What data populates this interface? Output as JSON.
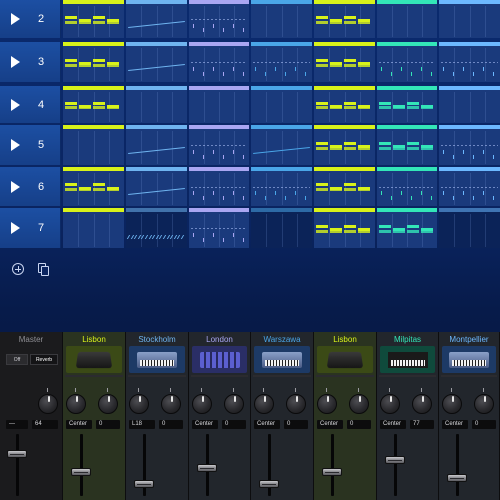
{
  "colors": {
    "lime": "#d8f21a",
    "blue": "#6fb4f0",
    "lavender": "#a9a6f2",
    "sky": "#4aa6e8",
    "teal": "#33e6b8",
    "lightblue": "#6cb8ff"
  },
  "grid": {
    "rows": [
      {
        "number": "2",
        "play_icon": "play-icon"
      },
      {
        "number": "3",
        "play_icon": "play-icon"
      },
      {
        "number": "4",
        "play_icon": "play-icon"
      },
      {
        "number": "5",
        "play_icon": "play-icon"
      },
      {
        "number": "6",
        "play_icon": "play-icon"
      },
      {
        "number": "7",
        "play_icon": "play-icon"
      }
    ]
  },
  "toolbar": {
    "add_icon": "add-circle-icon",
    "duplicate_icon": "duplicate-icon"
  },
  "mixer": {
    "master": {
      "name": "Master",
      "off_label": "Off",
      "reverb_label": "Reverb",
      "value_left": "—",
      "value_right": "64"
    },
    "channels": [
      {
        "name": "Lisbon",
        "pan": "Center",
        "send": "0",
        "instrument": "drum-machine-icon"
      },
      {
        "name": "Stockholm",
        "pan": "L18",
        "send": "0",
        "instrument": "synth-icon"
      },
      {
        "name": "London",
        "pan": "Center",
        "send": "0",
        "instrument": "drum-pad-icon"
      },
      {
        "name": "Warszawa",
        "pan": "Center",
        "send": "0",
        "instrument": "synth-icon"
      },
      {
        "name": "Lisbon",
        "pan": "Center",
        "send": "0",
        "instrument": "drum-machine-icon"
      },
      {
        "name": "Milpitas",
        "pan": "Center",
        "send": "77",
        "instrument": "keyboard-icon"
      },
      {
        "name": "Montpellier",
        "pan": "Center",
        "send": "0",
        "instrument": "synth-icon"
      }
    ]
  }
}
